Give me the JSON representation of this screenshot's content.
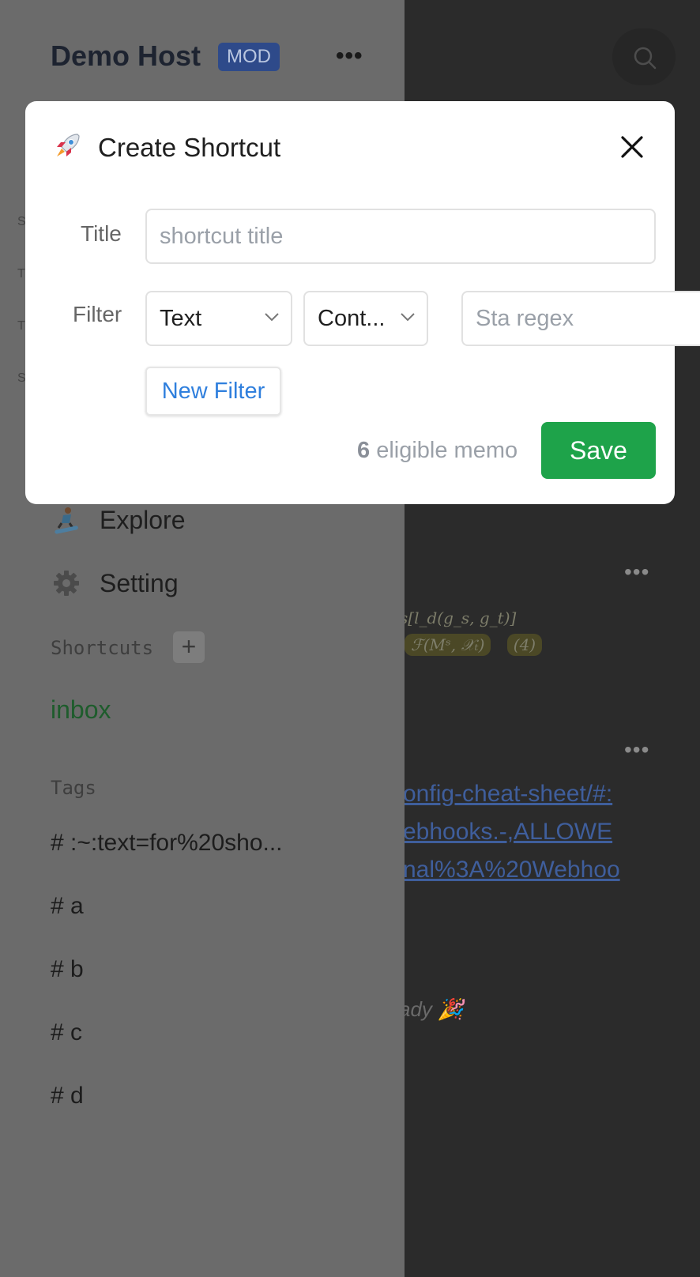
{
  "sidebar": {
    "brand": "Demo Host",
    "badge": "MOD",
    "menu_dots": "•••",
    "nav": [
      {
        "label": "Explore",
        "icon": "snowboarder-icon"
      },
      {
        "label": "Setting",
        "icon": "gear-icon"
      }
    ],
    "shortcuts_label": "Shortcuts",
    "add_shortcut": "+",
    "shortcuts": [
      "inbox"
    ],
    "tags_label": "Tags",
    "tags": [
      "# :~:text=for%20sho...",
      "# a",
      "# b",
      "# c",
      "# d"
    ]
  },
  "main": {
    "memo_dots": "•••",
    "formula_line1": "s[l_d(g_s, g_t)]",
    "formula_hl": "ℱ(Mˢ, 𝒳ₜ)",
    "formula_num": "(4)",
    "link_lines": [
      "onfig-cheat-sheet/#:",
      "ebhooks.-,ALLOWE",
      "nal%3A%20Webhoo"
    ],
    "ready_text": "ady 🎉"
  },
  "modal": {
    "title": "Create Shortcut",
    "title_icon": "rocket-icon",
    "title_label": "Title",
    "title_placeholder": "shortcut title",
    "filter_label": "Filter",
    "filter_type": "Text",
    "filter_operator": "Cont...",
    "filter_value_placeholder": "Sta regex",
    "new_filter": "New Filter",
    "eligible_count": "6",
    "eligible_text": "eligible memo",
    "save": "Save"
  },
  "colors": {
    "save_green": "#1ea34a",
    "link_blue": "#2f7fdd",
    "shortcut_green": "#1e5c2c",
    "badge_blue": "#2e4a8a"
  }
}
